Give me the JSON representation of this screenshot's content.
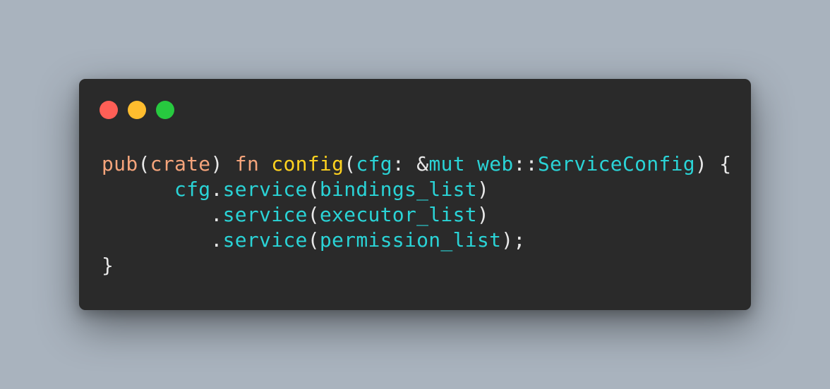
{
  "window": {
    "controls": [
      {
        "name": "close-button",
        "color": "#ff5f56"
      },
      {
        "name": "minimize-button",
        "color": "#ffbd2e"
      },
      {
        "name": "maximize-button",
        "color": "#27c93f"
      }
    ]
  },
  "code": {
    "lines": [
      [
        {
          "t": "pub",
          "c": "kw"
        },
        {
          "t": "(",
          "c": "punct"
        },
        {
          "t": "crate",
          "c": "kw"
        },
        {
          "t": ") ",
          "c": "punct"
        },
        {
          "t": "fn",
          "c": "kw"
        },
        {
          "t": " ",
          "c": "punct"
        },
        {
          "t": "config",
          "c": "fn"
        },
        {
          "t": "(",
          "c": "punct"
        },
        {
          "t": "cfg",
          "c": "id"
        },
        {
          "t": ": &",
          "c": "punct"
        },
        {
          "t": "mut",
          "c": "id"
        },
        {
          "t": " ",
          "c": "punct"
        },
        {
          "t": "web",
          "c": "id"
        },
        {
          "t": "::",
          "c": "punct"
        },
        {
          "t": "ServiceConfig",
          "c": "id"
        },
        {
          "t": ") {",
          "c": "punct"
        }
      ],
      [
        {
          "t": "      ",
          "c": "punct"
        },
        {
          "t": "cfg",
          "c": "id"
        },
        {
          "t": ".",
          "c": "punct"
        },
        {
          "t": "service",
          "c": "id"
        },
        {
          "t": "(",
          "c": "punct"
        },
        {
          "t": "bindings_list",
          "c": "id"
        },
        {
          "t": ")",
          "c": "punct"
        }
      ],
      [
        {
          "t": "         .",
          "c": "punct"
        },
        {
          "t": "service",
          "c": "id"
        },
        {
          "t": "(",
          "c": "punct"
        },
        {
          "t": "executor_list",
          "c": "id"
        },
        {
          "t": ")",
          "c": "punct"
        }
      ],
      [
        {
          "t": "         .",
          "c": "punct"
        },
        {
          "t": "service",
          "c": "id"
        },
        {
          "t": "(",
          "c": "punct"
        },
        {
          "t": "permission_list",
          "c": "id"
        },
        {
          "t": ");",
          "c": "punct"
        }
      ],
      [
        {
          "t": "}",
          "c": "punct"
        }
      ]
    ]
  }
}
